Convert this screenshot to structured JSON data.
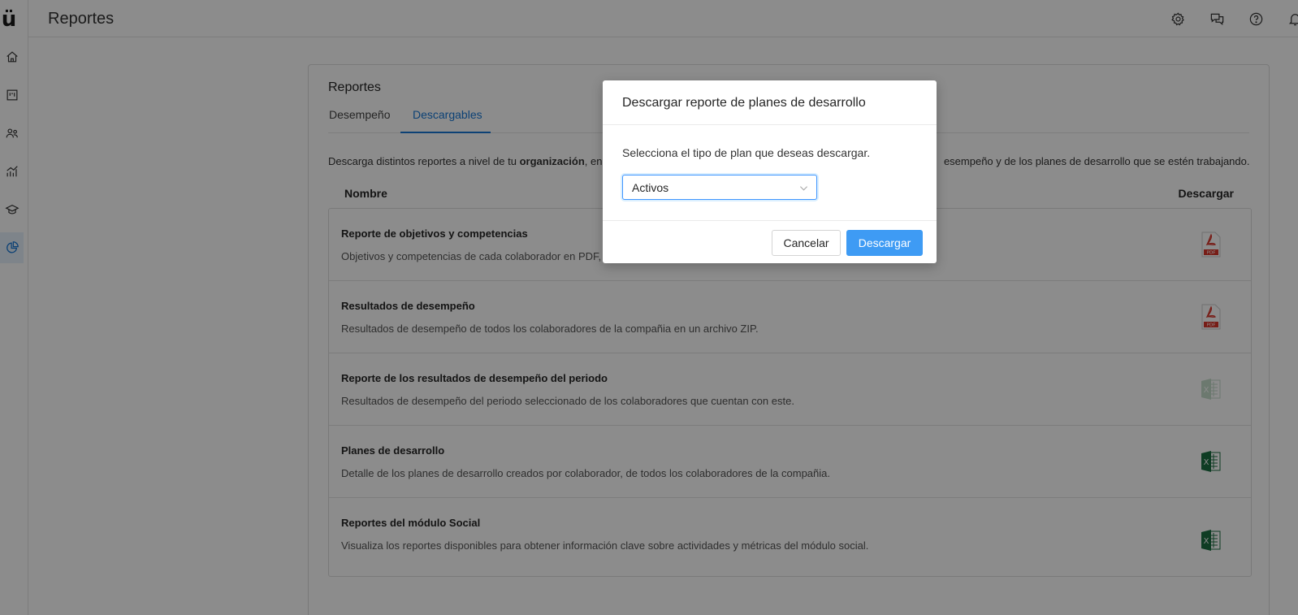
{
  "app": {
    "logo": "ü",
    "title": "Reportes"
  },
  "rail": {
    "items": [
      {
        "icon": "home-icon"
      },
      {
        "icon": "board-icon"
      },
      {
        "icon": "people-icon"
      },
      {
        "icon": "chart-icon"
      },
      {
        "icon": "graduation-cap-icon"
      },
      {
        "icon": "pie-chart-icon",
        "active": true
      }
    ]
  },
  "header": {
    "icons": [
      "gear-icon",
      "chat-icon",
      "help-icon",
      "bell-icon"
    ]
  },
  "card": {
    "title": "Reportes",
    "tabs": [
      {
        "label": "Desempeño"
      },
      {
        "label": "Descargables",
        "active": true
      }
    ],
    "description_start": "Descarga distintos reportes a nivel de tu ",
    "description_bold": "organización",
    "description_mid": ", en l",
    "description_end": "esempeño y de los planes de desarrollo que se estén trabajando.",
    "columns": {
      "name": "Nombre",
      "download": "Descargar"
    },
    "rows": [
      {
        "title": "Reporte de objetivos y competencias",
        "desc": "Objetivos y competencias de cada colaborador en PDF, e",
        "icon": "pdf-icon"
      },
      {
        "title": "Resultados de desempeño",
        "desc": "Resultados de desempeño de todos los colaboradores de la compañia en un archivo ZIP.",
        "icon": "pdf-icon"
      },
      {
        "title": "Reporte de los resultados de desempeño del periodo",
        "desc": "Resultados de desempeño del periodo seleccionado de los colaboradores que cuentan con este.",
        "icon": "excel-icon-disabled"
      },
      {
        "title": "Planes de desarrollo",
        "desc": "Detalle de los planes de desarrollo creados por colaborador, de todos los colaboradores de la compañia.",
        "icon": "excel-icon"
      },
      {
        "title": "Reportes del módulo Social",
        "desc": "Visualiza los reportes disponibles para obtener información clave sobre actividades y métricas del módulo social.",
        "icon": "excel-icon"
      }
    ]
  },
  "modal": {
    "title": "Descargar reporte de planes de desarrollo",
    "prompt": "Selecciona el tipo de plan que deseas descargar.",
    "select_value": "Activos",
    "cancel_label": "Cancelar",
    "ok_label": "Descargar"
  },
  "colors": {
    "accent": "#1677d6",
    "primary_button": "#3e9bf4",
    "pdf_red": "#d9362b",
    "excel_green": "#1d6f42"
  }
}
